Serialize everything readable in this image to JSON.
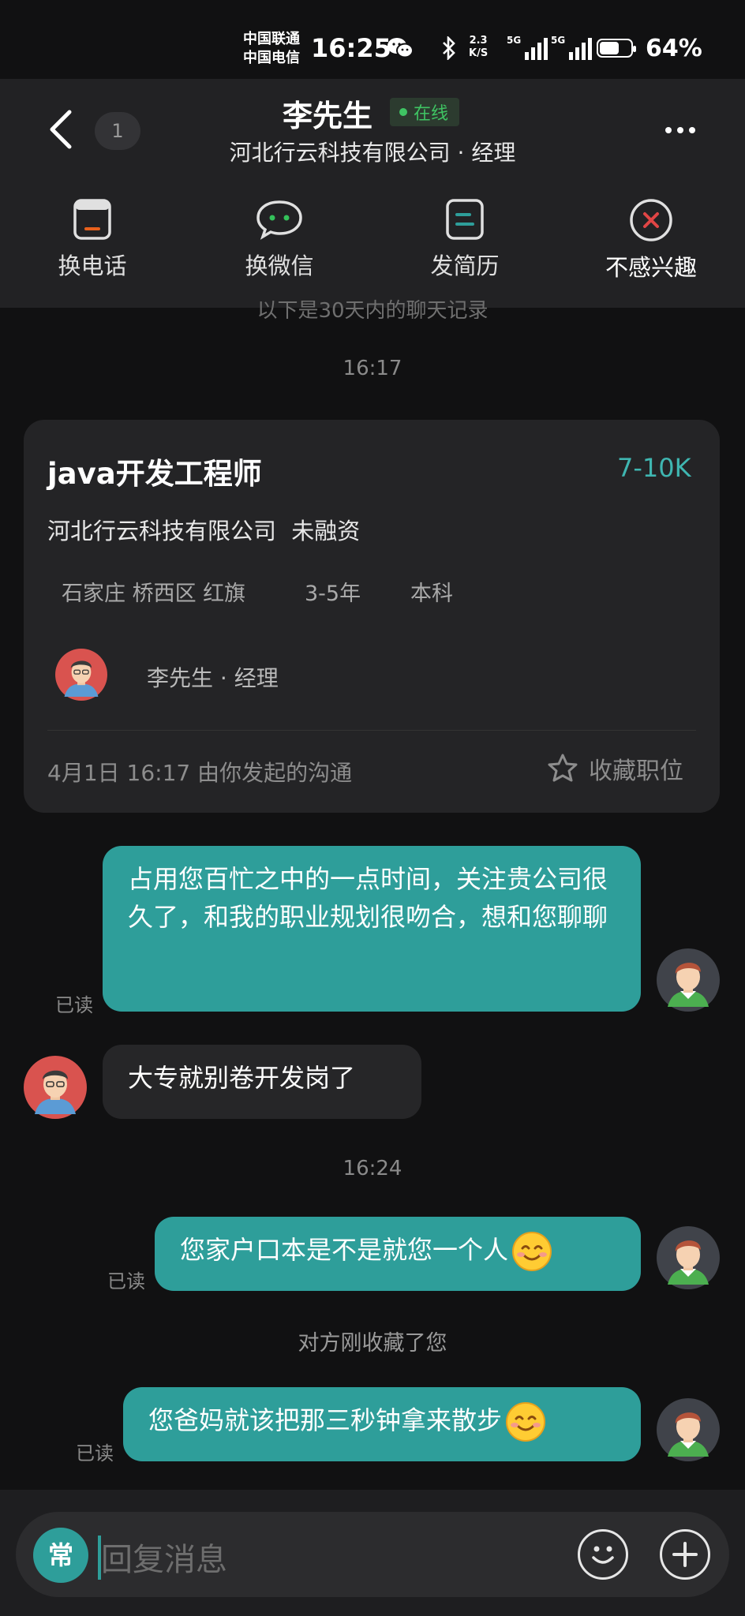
{
  "status_bar": {
    "carrier_1": "中国联通",
    "carrier_2": "中国电信",
    "time": "16:25",
    "net_speed_value": "2.3",
    "net_speed_unit": "K/S",
    "signal_1_label": "5G",
    "signal_2_label": "5G",
    "battery_percent": "64%",
    "battery_level": 0.64
  },
  "header": {
    "unread_count": "1",
    "contact_name": "李先生",
    "online_status": "在线",
    "subtitle": "河北行云科技有限公司 · 经理"
  },
  "actions": [
    {
      "label": "换电话",
      "icon": "phone-card-icon"
    },
    {
      "label": "换微信",
      "icon": "wechat-bubble-icon"
    },
    {
      "label": "发简历",
      "icon": "resume-icon"
    },
    {
      "label": "不感兴趣",
      "icon": "close-circle-icon"
    }
  ],
  "chat": {
    "history_note": "以下是30天内的聊天记录",
    "time_1": "16:17",
    "time_2": "16:24",
    "system_note": "对方刚收藏了您",
    "read_label": "已读"
  },
  "job_card": {
    "title": "java开发工程师",
    "salary": "7-10K",
    "company": "河北行云科技有限公司",
    "funding": "未融资",
    "location": "石家庄 桥西区 红旗",
    "experience": "3-5年",
    "education": "本科",
    "recruiter": "李先生 · 经理",
    "footer": "4月1日 16:17 由你发起的沟通",
    "favorite_label": "收藏职位"
  },
  "messages": [
    {
      "sender": "me",
      "text": "占用您百忙之中的一点时间，关注贵公司很久了，和我的职业规划很吻合，想和您聊聊",
      "read": "已读"
    },
    {
      "sender": "them",
      "text": "大专就别卷开发岗了"
    },
    {
      "sender": "me",
      "text": "您家户口本是不是就您一个人",
      "emoji": "smile-emoji",
      "read": "已读"
    },
    {
      "sender": "me",
      "text": "您爸妈就该把那三秒钟拿来散步",
      "emoji": "smile-emoji",
      "read": "已读"
    }
  ],
  "input": {
    "quick_label": "常",
    "placeholder": "回复消息"
  },
  "colors": {
    "accent": "#2e9e9a",
    "online": "#3fc463",
    "danger": "#e04545",
    "salary": "#3fb6b1"
  }
}
